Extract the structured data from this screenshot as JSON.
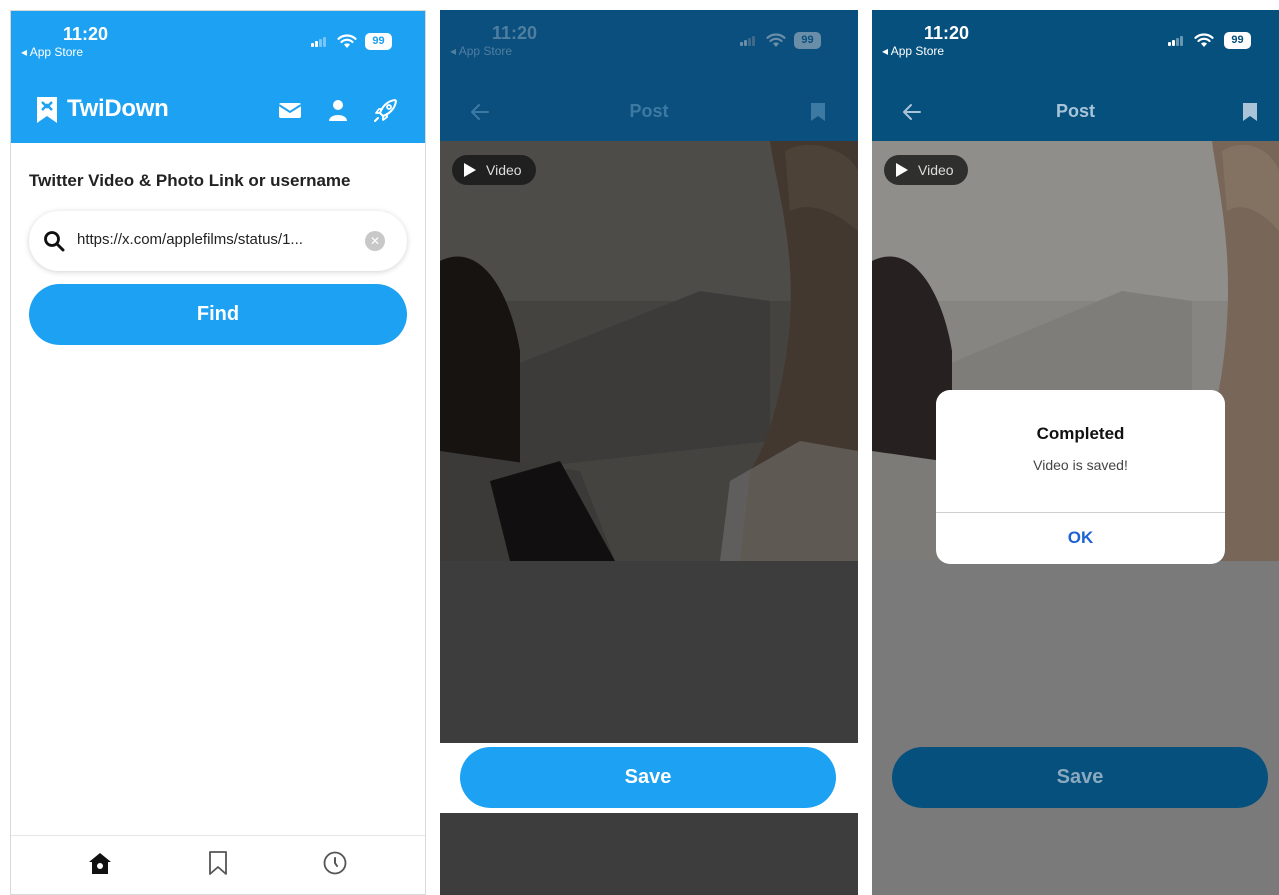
{
  "status_bar": {
    "time": "11:20",
    "back_app": "◂ App Store",
    "battery": "99"
  },
  "home_screen": {
    "brand": "TwiDown",
    "field_label": "Twitter Video & Photo Link or username",
    "search": {
      "value": "https://x.com/applefilms/status/1...",
      "placeholder": ""
    },
    "find_label": "Find",
    "header_icons": [
      "mail-icon",
      "user-icon",
      "rocket-icon"
    ],
    "tabs": [
      "home-icon",
      "bookmark-icon",
      "history-icon"
    ]
  },
  "post_screen": {
    "title": "Post",
    "media_badge": "Video",
    "save_label": "Save"
  },
  "saved_screen": {
    "title": "Post",
    "media_badge": "Video",
    "save_label": "Save",
    "dialog": {
      "title": "Completed",
      "message": "Video is saved!",
      "ok_label": "OK"
    }
  },
  "colors": {
    "brand_blue": "#1da1f2",
    "dimmed_header": "#06507e",
    "dialog_ok": "#1d62d6",
    "panel2_bg": "#3d3d3d",
    "panel3_bg": "#7a7a7a"
  }
}
